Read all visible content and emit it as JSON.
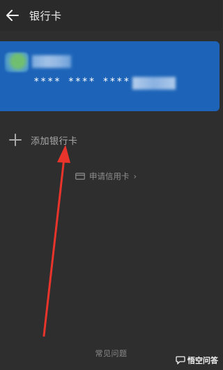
{
  "header": {
    "title": "银行卡",
    "back_icon": "arrow-left-icon"
  },
  "card": {
    "number_masked": "**** **** ****",
    "accent_color": "#1d64b8"
  },
  "add_card": {
    "label": "添加银行卡",
    "icon": "plus-icon"
  },
  "apply_credit": {
    "label": "申请信用卡",
    "chevron": "›",
    "icon": "card-icon"
  },
  "footer": {
    "faq_label": "常见问题"
  },
  "watermark": {
    "text": "悟空问答"
  },
  "annotation": {
    "arrow_color": "#e8342b"
  }
}
